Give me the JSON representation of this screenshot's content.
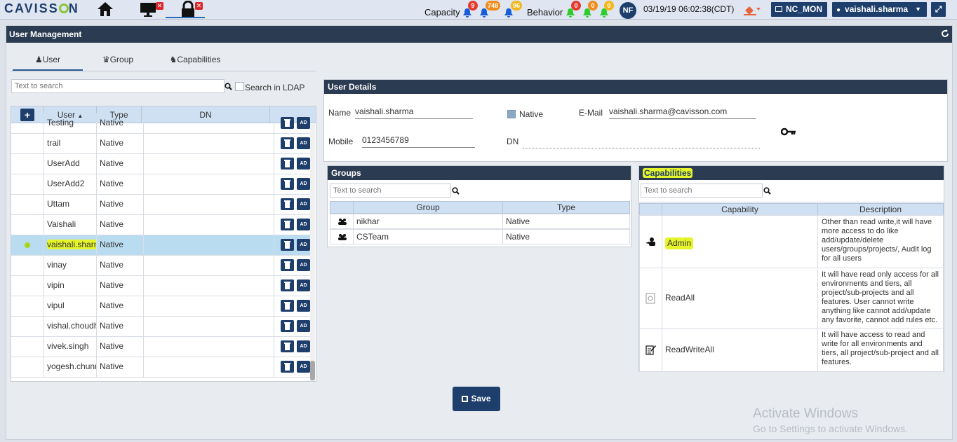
{
  "topbar": {
    "logo_left": "CAVISS",
    "logo_right": "N",
    "capacity_label": "Capacity",
    "capacity_counts": [
      "9",
      "748",
      "96"
    ],
    "behavior_label": "Behavior",
    "behavior_counts": [
      "0",
      "0",
      "0"
    ],
    "avatar_initials": "NF",
    "datetime": "03/19/19 06:02:38(CDT)",
    "monitor_button": "NC_MON",
    "user_button": "vaishali.sharma"
  },
  "page": {
    "title": "User Management"
  },
  "tabs": [
    "User",
    "Group",
    "Capabilities"
  ],
  "user_search": {
    "placeholder": "Text to search",
    "ldap_label": "Search in LDAP"
  },
  "user_table": {
    "headers": [
      "User",
      "Type",
      "DN"
    ],
    "rows": [
      {
        "user": "Testing",
        "type": "Native"
      },
      {
        "user": "trail",
        "type": "Native"
      },
      {
        "user": "UserAdd",
        "type": "Native"
      },
      {
        "user": "UserAdd2",
        "type": "Native"
      },
      {
        "user": "Uttam",
        "type": "Native"
      },
      {
        "user": "Vaishali",
        "type": "Native"
      },
      {
        "user": "vaishali.sharma",
        "type": "Native"
      },
      {
        "user": "vinay",
        "type": "Native"
      },
      {
        "user": "vipin",
        "type": "Native"
      },
      {
        "user": "vipul",
        "type": "Native"
      },
      {
        "user": "vishal.choudhury",
        "type": "Native"
      },
      {
        "user": "vivek.singh",
        "type": "Native"
      },
      {
        "user": "yogesh.chunnilal",
        "type": "Native"
      }
    ],
    "ad_label": "AD"
  },
  "details": {
    "title": "User Details",
    "name_label": "Name",
    "name": "vaishali.sharma",
    "native_label": "Native",
    "email_label": "E-Mail",
    "email": "vaishali.sharma@cavisson.com",
    "mobile_label": "Mobile",
    "mobile": "0123456789",
    "dn_label": "DN"
  },
  "groups": {
    "title": "Groups",
    "search_placeholder": "Text to search",
    "headers": [
      "Group",
      "Type"
    ],
    "rows": [
      {
        "group": "nikhar",
        "type": "Native"
      },
      {
        "group": "CSTeam",
        "type": "Native"
      }
    ]
  },
  "capabilities": {
    "title": "Capabilities",
    "search_placeholder": "Text to search",
    "headers": [
      "Capability",
      "Description"
    ],
    "rows": [
      {
        "name": "Admin",
        "desc": "Other than read write,it will have more access to do like add/update/delete users/groups/projects/, Audit log for all users"
      },
      {
        "name": "ReadAll",
        "desc": "It will have read only access for all environments and tiers, all project/sub-projects and all features. User cannot write anything like cannot add/update any favorite, cannot add rules etc."
      },
      {
        "name": "ReadWriteAll",
        "desc": "It will have access to read and write for all environments and tiers, all project/sub-project and all features."
      }
    ]
  },
  "save_label": "Save",
  "watermark": {
    "line1": "Activate Windows",
    "line2": "Go to Settings to activate Windows."
  },
  "colors": {
    "navy": "#1e3e6c",
    "header": "#2b3b52",
    "highlight": "#e5f52a",
    "selected_row": "#b9dcf0",
    "alert_red": "#e63a2e",
    "alert_green": "#2ecc2e"
  }
}
